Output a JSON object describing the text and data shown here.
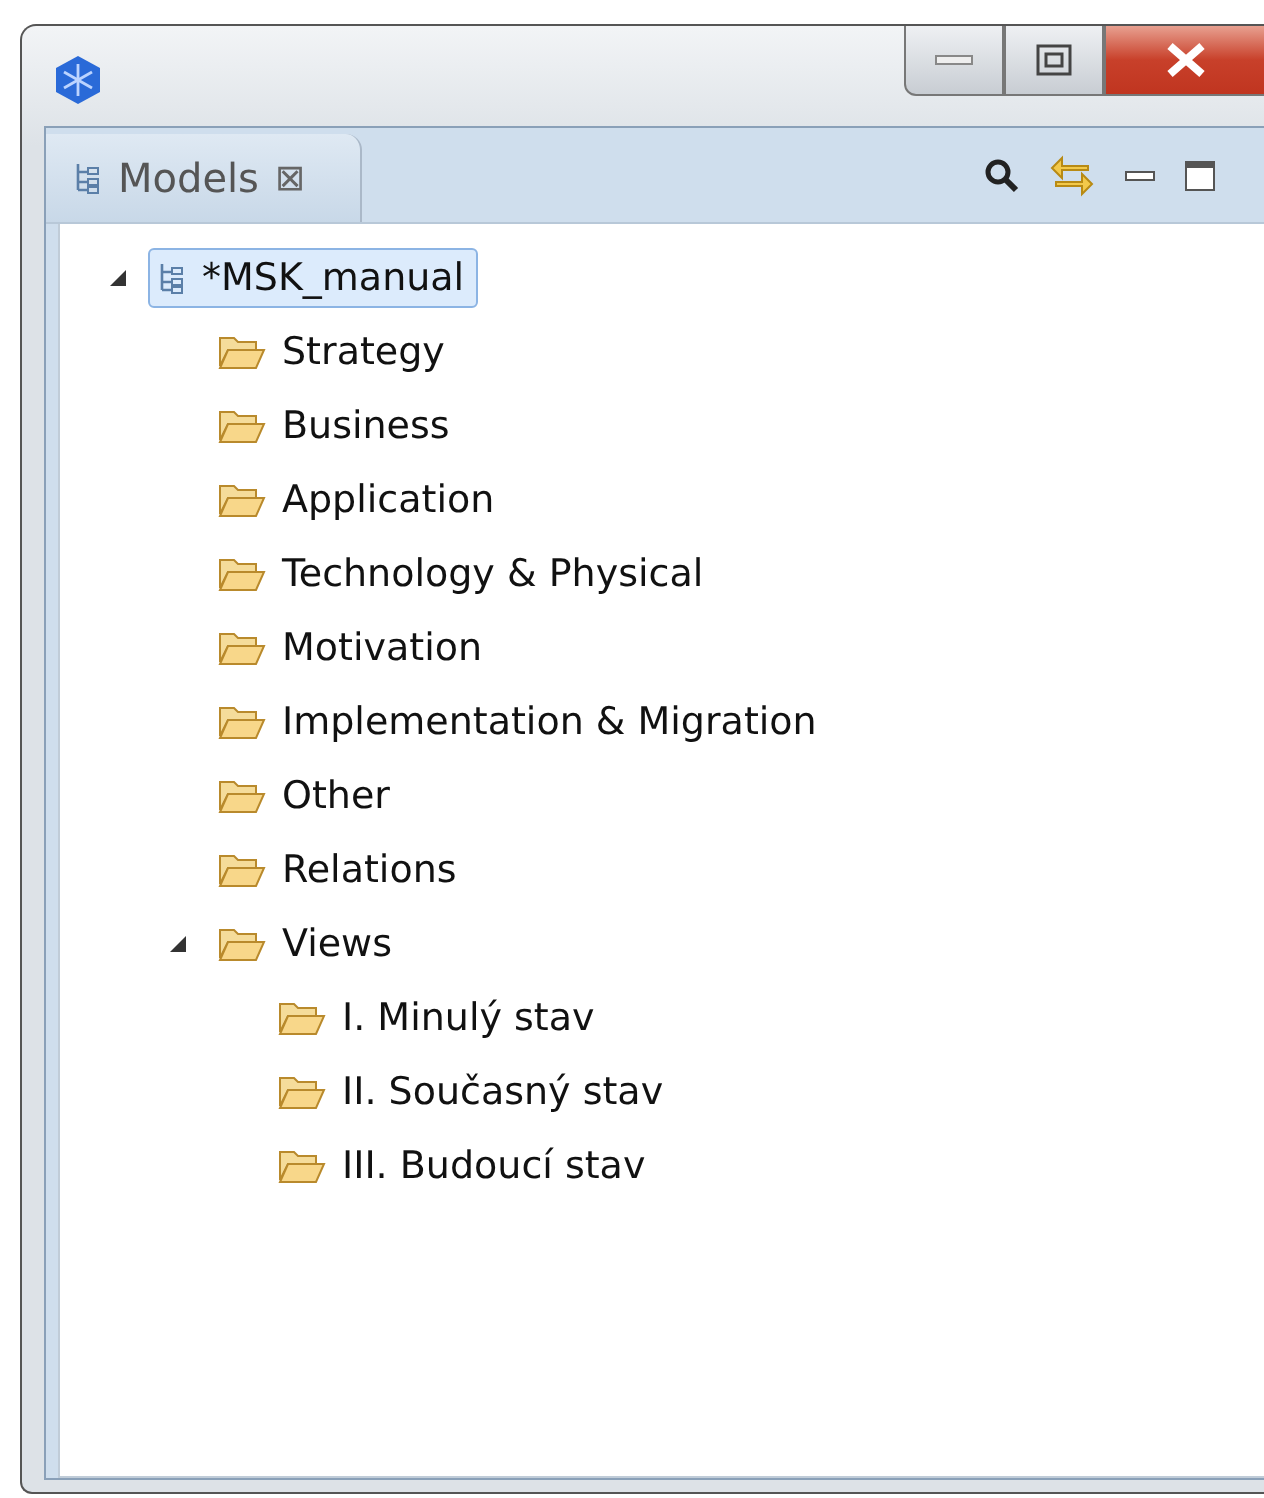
{
  "panel": {
    "tab": {
      "label": "Models",
      "close": "⊠",
      "selected": true
    }
  },
  "tree": [
    {
      "label": "*MSK_manual",
      "kind": "model",
      "selected": true,
      "expanded": true,
      "children": [
        {
          "label": "Strategy",
          "kind": "folder",
          "selected": false
        },
        {
          "label": "Business",
          "kind": "folder",
          "selected": false
        },
        {
          "label": "Application",
          "kind": "folder",
          "selected": false
        },
        {
          "label": "Technology & Physical",
          "kind": "folder",
          "selected": false
        },
        {
          "label": "Motivation",
          "kind": "folder",
          "selected": false
        },
        {
          "label": "Implementation & Migration",
          "kind": "folder",
          "selected": false
        },
        {
          "label": "Other",
          "kind": "folder",
          "selected": false
        },
        {
          "label": "Relations",
          "kind": "folder",
          "selected": false
        },
        {
          "label": "Views",
          "kind": "folder",
          "selected": false,
          "expanded": true,
          "children": [
            {
              "label": "I. Minulý stav",
              "kind": "folder",
              "selected": false
            },
            {
              "label": "II. Současný stav",
              "kind": "folder",
              "selected": false
            },
            {
              "label": "III. Budoucí stav",
              "kind": "folder",
              "selected": false
            }
          ]
        }
      ]
    }
  ]
}
